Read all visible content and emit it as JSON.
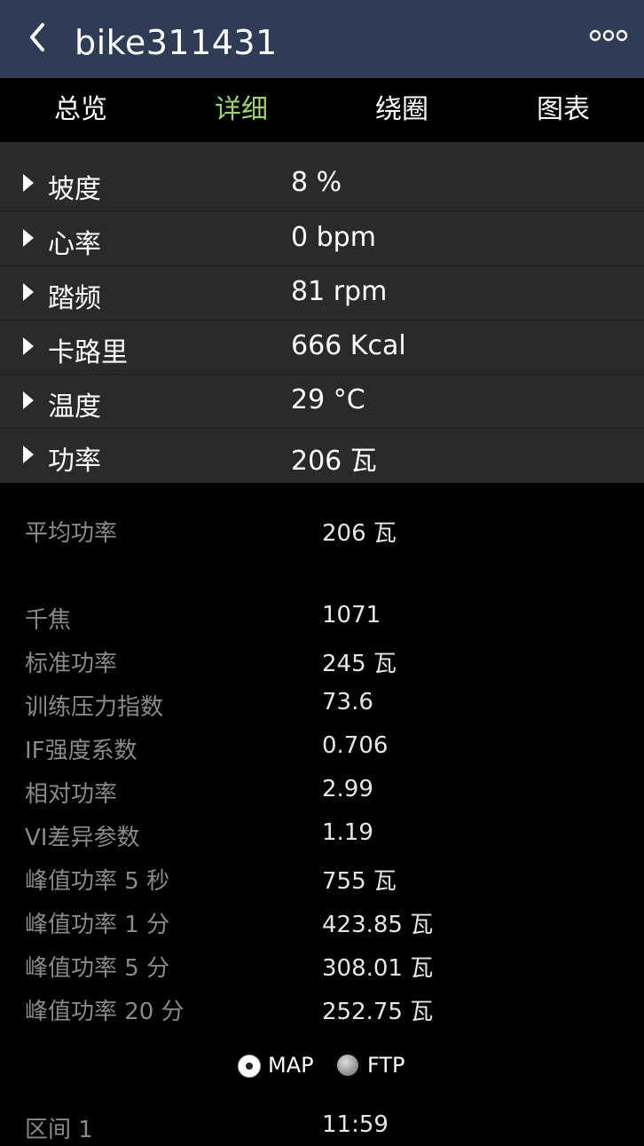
{
  "header": {
    "title": "bike311431",
    "back_icon": "chevron-left-icon",
    "more_icon": "more-dots-icon"
  },
  "tabs": [
    {
      "label": "总览",
      "active": false
    },
    {
      "label": "详细",
      "active": true
    },
    {
      "label": "绕圈",
      "active": false
    },
    {
      "label": "图表",
      "active": false
    }
  ],
  "summary": [
    {
      "label": "坡度",
      "value": "8 %"
    },
    {
      "label": "心率",
      "value": "0 bpm"
    },
    {
      "label": "踏频",
      "value": "81 rpm"
    },
    {
      "label": "卡路里",
      "value": "666 Kcal"
    },
    {
      "label": "温度",
      "value": "29 °C"
    },
    {
      "label": "功率",
      "value": "206 瓦"
    }
  ],
  "details": [
    {
      "label": "平均功率",
      "value": "206 瓦"
    },
    {
      "label": "千焦",
      "value": "1071"
    },
    {
      "label": "标准功率",
      "value": "245 瓦"
    },
    {
      "label": "训练压力指数",
      "value": "73.6"
    },
    {
      "label": "IF强度系数",
      "value": "0.706"
    },
    {
      "label": "相对功率",
      "value": "2.99"
    },
    {
      "label": "VI差异参数",
      "value": "1.19"
    },
    {
      "label": "峰值功率 5 秒",
      "value": "755 瓦"
    },
    {
      "label": "峰值功率 1 分",
      "value": "423.85 瓦"
    },
    {
      "label": "峰值功率 5 分",
      "value": "308.01 瓦"
    },
    {
      "label": "峰值功率 20 分",
      "value": "252.75 瓦"
    }
  ],
  "mode": {
    "options": [
      "MAP",
      "FTP"
    ],
    "selected": "MAP"
  },
  "zones": [
    {
      "label": "区间 1",
      "value": "11:59"
    }
  ],
  "colors": {
    "header_bg": "#2e3c55",
    "active_tab": "#9bd36a"
  }
}
